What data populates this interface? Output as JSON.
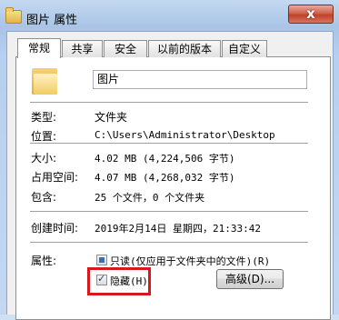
{
  "window": {
    "title": "图片 属性",
    "close_label": "x"
  },
  "tabs": [
    {
      "label": "常规",
      "active": true
    },
    {
      "label": "共享",
      "active": false
    },
    {
      "label": "安全",
      "active": false
    },
    {
      "label": "以前的版本",
      "active": false
    },
    {
      "label": "自定义",
      "active": false
    }
  ],
  "general": {
    "name_value": "图片",
    "type_label": "类型:",
    "type_value": "文件夹",
    "location_label": "位置:",
    "location_value": "C:\\Users\\Administrator\\Desktop",
    "size_label": "大小:",
    "size_value": "4.02 MB (4,224,506 字节)",
    "disk_size_label": "占用空间:",
    "disk_size_value": "4.07 MB (4,268,032 字节)",
    "contains_label": "包含:",
    "contains_value": "25 个文件，0 个文件夹",
    "created_label": "创建时间:",
    "created_value": "2019年2月14日 星期四，21:33:42",
    "attributes_label": "属性:",
    "readonly_label": "只读(仅应用于文件夹中的文件)(R)",
    "readonly_state": "indeterminate",
    "hidden_label": "隐藏(H)",
    "hidden_state": "checked",
    "advanced_label": "高级(D)..."
  },
  "colors": {
    "highlight_box": "#d7191c",
    "close_button": "#c0412b"
  },
  "icons": {
    "title_icon": "folder-icon",
    "large_icon": "folder-icon"
  }
}
